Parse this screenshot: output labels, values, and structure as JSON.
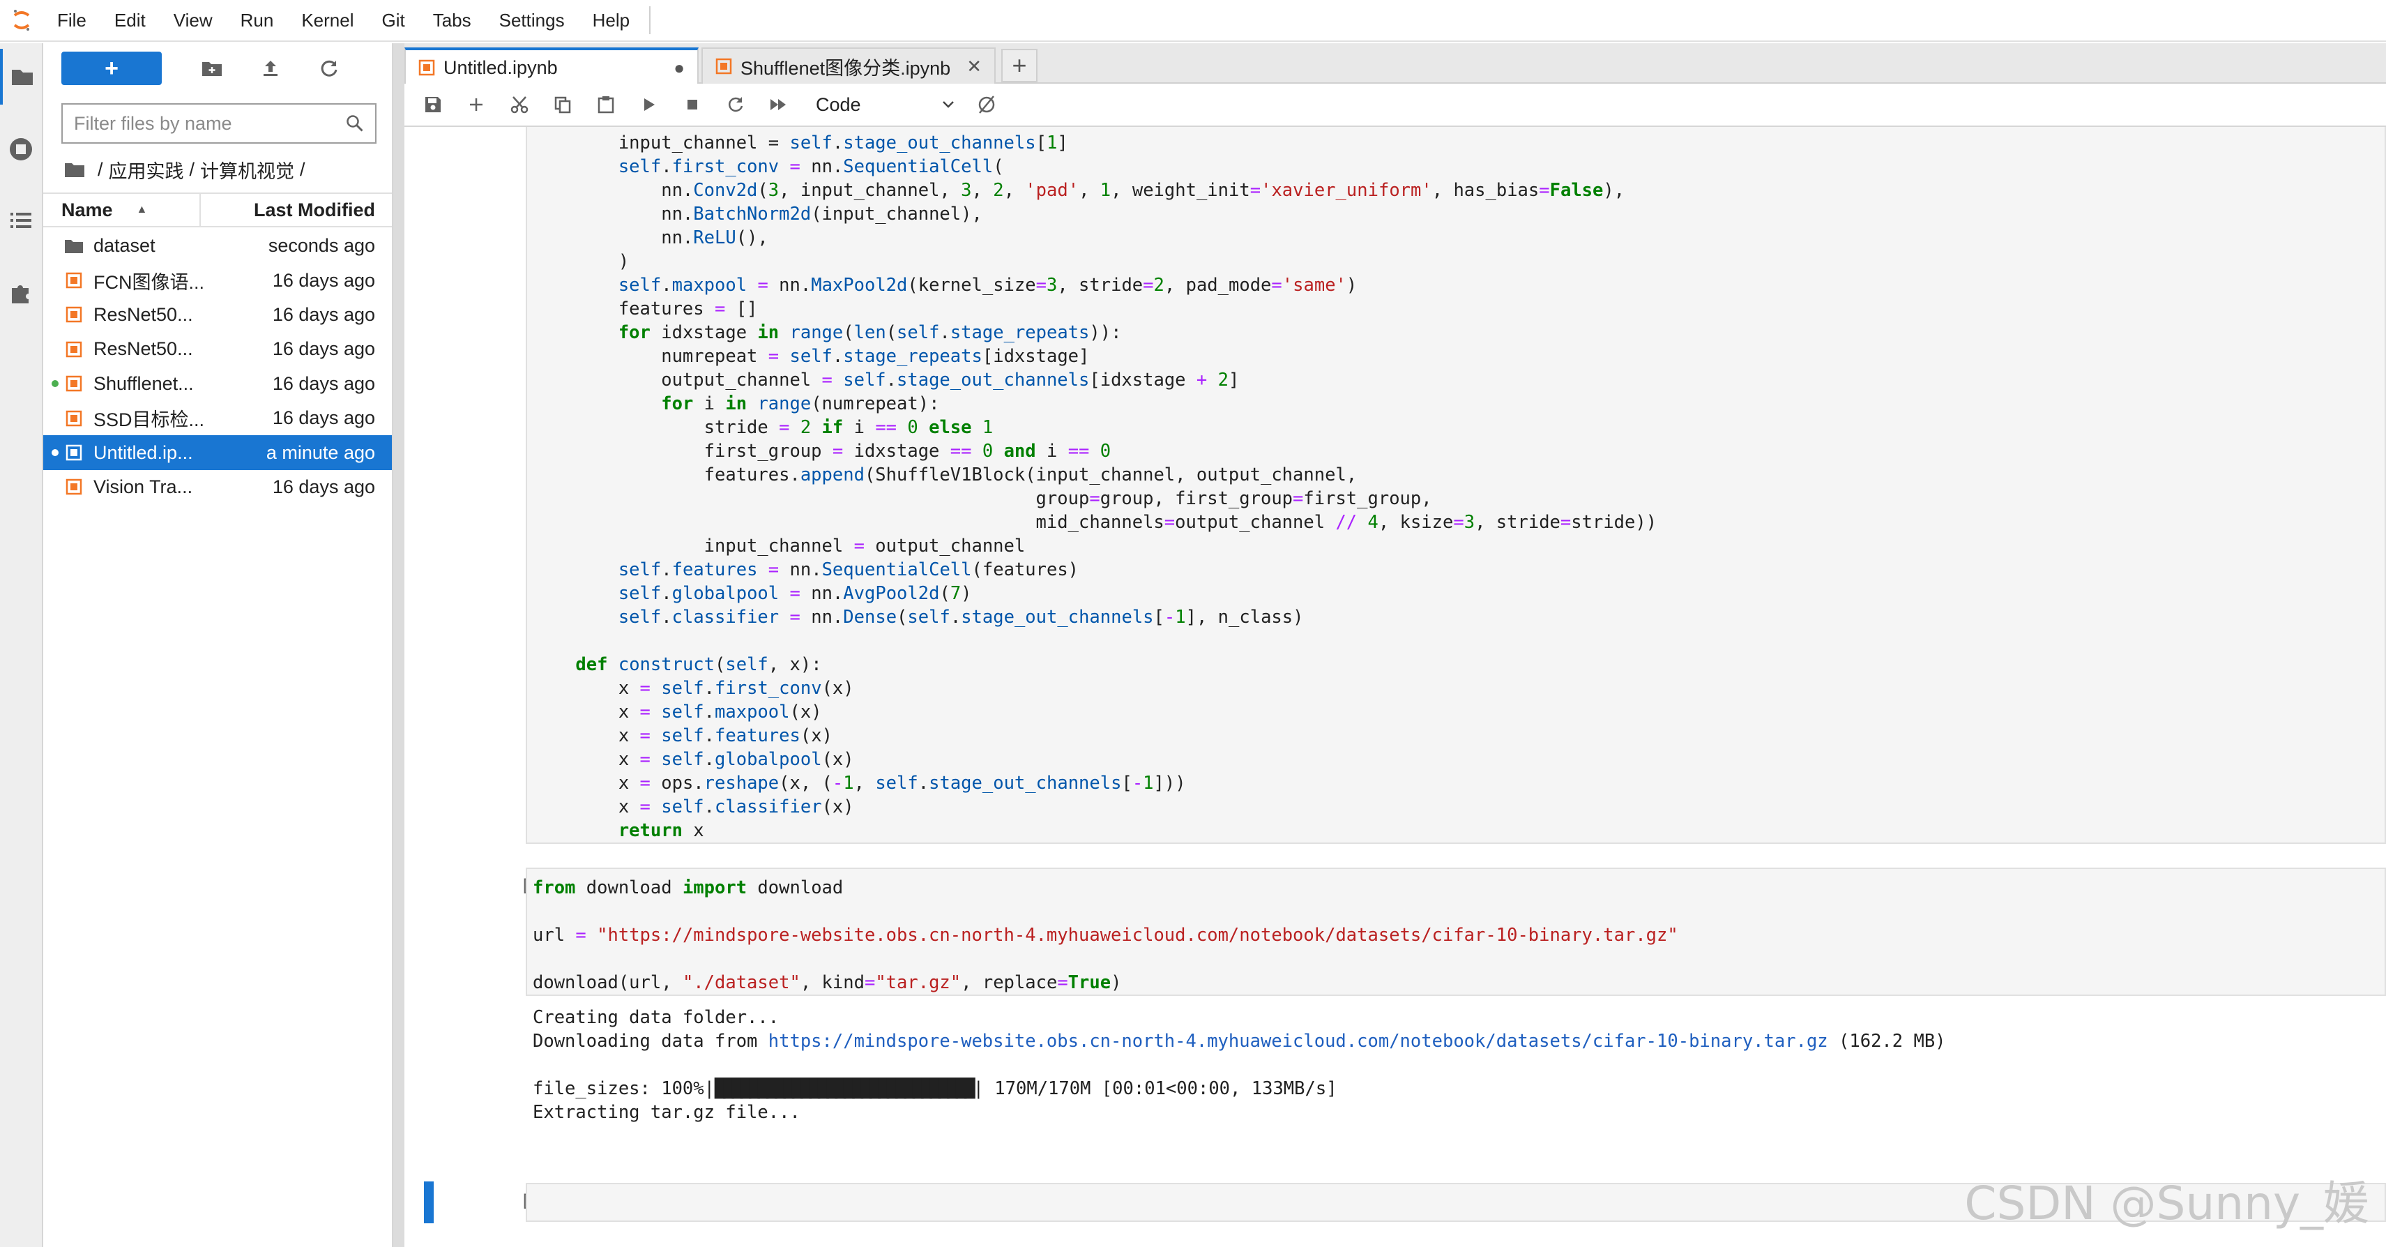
{
  "menubar": {
    "items": [
      "File",
      "Edit",
      "View",
      "Run",
      "Kernel",
      "Git",
      "Tabs",
      "Settings",
      "Help"
    ]
  },
  "activity_bar": {
    "items": [
      "folder-icon",
      "running-icon",
      "toc-icon",
      "extension-icon"
    ]
  },
  "filebrowser": {
    "new_button": "+",
    "filter_placeholder": "Filter files by name",
    "breadcrumbs": [
      "/",
      "应用实践",
      "/",
      "计算机视觉",
      "/"
    ],
    "col_name": "Name",
    "col_modified": "Last Modified",
    "files": [
      {
        "name": "dataset",
        "modified": "seconds ago",
        "type": "folder",
        "running": false,
        "selected": false
      },
      {
        "name": "FCN图像语...",
        "modified": "16 days ago",
        "type": "notebook",
        "running": false,
        "selected": false
      },
      {
        "name": "ResNet50...",
        "modified": "16 days ago",
        "type": "notebook",
        "running": false,
        "selected": false
      },
      {
        "name": "ResNet50...",
        "modified": "16 days ago",
        "type": "notebook",
        "running": false,
        "selected": false
      },
      {
        "name": "Shufflenet...",
        "modified": "16 days ago",
        "type": "notebook",
        "running": true,
        "selected": false
      },
      {
        "name": "SSD目标检...",
        "modified": "16 days ago",
        "type": "notebook",
        "running": false,
        "selected": false
      },
      {
        "name": "Untitled.ip...",
        "modified": "a minute ago",
        "type": "notebook",
        "running": true,
        "selected": true
      },
      {
        "name": "Vision Tra...",
        "modified": "16 days ago",
        "type": "notebook",
        "running": false,
        "selected": false
      }
    ]
  },
  "tabs": [
    {
      "label": "Untitled.ipynb",
      "active": true,
      "status": "●"
    },
    {
      "label": "Shufflenet图像分类.ipynb",
      "active": false,
      "status": "✕"
    }
  ],
  "new_tab": "+",
  "toolbar": {
    "cell_type": "Code"
  },
  "cells": [
    {
      "prompt": "",
      "code_html": "        input_channel = <span class=\"self\">self</span>.<span class=\"fn\">stage_out_channels</span>[<span class=\"num\">1</span>]\n        <span class=\"self\">self</span>.<span class=\"fn\">first_conv</span> <span class=\"op\">=</span> nn.<span class=\"fn\">SequentialCell</span>(\n            nn.<span class=\"fn\">Conv2d</span>(<span class=\"num\">3</span>, input_channel, <span class=\"num\">3</span>, <span class=\"num\">2</span>, <span class=\"str\">'pad'</span>, <span class=\"num\">1</span>, weight_init<span class=\"op\">=</span><span class=\"str\">'xavier_uniform'</span>, has_bias<span class=\"op\">=</span><span class=\"kw\">False</span>),\n            nn.<span class=\"fn\">BatchNorm2d</span>(input_channel),\n            nn.<span class=\"fn\">ReLU</span>(),\n        )\n        <span class=\"self\">self</span>.<span class=\"fn\">maxpool</span> <span class=\"op\">=</span> nn.<span class=\"fn\">MaxPool2d</span>(kernel_size<span class=\"op\">=</span><span class=\"num\">3</span>, stride<span class=\"op\">=</span><span class=\"num\">2</span>, pad_mode<span class=\"op\">=</span><span class=\"str\">'same'</span>)\n        features <span class=\"op\">=</span> []\n        <span class=\"kw\">for</span> idxstage <span class=\"kw\">in</span> <span class=\"fn\">range</span>(<span class=\"fn\">len</span>(<span class=\"self\">self</span>.<span class=\"fn\">stage_repeats</span>)):\n            numrepeat <span class=\"op\">=</span> <span class=\"self\">self</span>.<span class=\"fn\">stage_repeats</span>[idxstage]\n            output_channel <span class=\"op\">=</span> <span class=\"self\">self</span>.<span class=\"fn\">stage_out_channels</span>[idxstage <span class=\"op\">+</span> <span class=\"num\">2</span>]\n            <span class=\"kw\">for</span> i <span class=\"kw\">in</span> <span class=\"fn\">range</span>(numrepeat):\n                stride <span class=\"op\">=</span> <span class=\"num\">2</span> <span class=\"kw\">if</span> i <span class=\"op\">==</span> <span class=\"num\">0</span> <span class=\"kw\">else</span> <span class=\"num\">1</span>\n                first_group <span class=\"op\">=</span> idxstage <span class=\"op\">==</span> <span class=\"num\">0</span> <span class=\"kw\">and</span> i <span class=\"op\">==</span> <span class=\"num\">0</span>\n                features.<span class=\"fn\">append</span>(ShuffleV1Block(input_channel, output_channel,\n                                               group<span class=\"op\">=</span>group, first_group<span class=\"op\">=</span>first_group,\n                                               mid_channels<span class=\"op\">=</span>output_channel <span class=\"op\">//</span> <span class=\"num\">4</span>, ksize<span class=\"op\">=</span><span class=\"num\">3</span>, stride<span class=\"op\">=</span>stride))\n                input_channel <span class=\"op\">=</span> output_channel\n        <span class=\"self\">self</span>.<span class=\"fn\">features</span> <span class=\"op\">=</span> nn.<span class=\"fn\">SequentialCell</span>(features)\n        <span class=\"self\">self</span>.<span class=\"fn\">globalpool</span> <span class=\"op\">=</span> nn.<span class=\"fn\">AvgPool2d</span>(<span class=\"num\">7</span>)\n        <span class=\"self\">self</span>.<span class=\"fn\">classifier</span> <span class=\"op\">=</span> nn.<span class=\"fn\">Dense</span>(<span class=\"self\">self</span>.<span class=\"fn\">stage_out_channels</span>[<span class=\"op\">-</span><span class=\"num\">1</span>], n_class)\n\n    <span class=\"kw\">def</span> <span class=\"fn\">construct</span>(<span class=\"self\">self</span>, x):\n        x <span class=\"op\">=</span> <span class=\"self\">self</span>.<span class=\"fn\">first_conv</span>(x)\n        x <span class=\"op\">=</span> <span class=\"self\">self</span>.<span class=\"fn\">maxpool</span>(x)\n        x <span class=\"op\">=</span> <span class=\"self\">self</span>.<span class=\"fn\">features</span>(x)\n        x <span class=\"op\">=</span> <span class=\"self\">self</span>.<span class=\"fn\">globalpool</span>(x)\n        x <span class=\"op\">=</span> ops.<span class=\"fn\">reshape</span>(x, (<span class=\"op\">-</span><span class=\"num\">1</span>, <span class=\"self\">self</span>.<span class=\"fn\">stage_out_channels</span>[<span class=\"op\">-</span><span class=\"num\">1</span>]))\n        x <span class=\"op\">=</span> <span class=\"self\">self</span>.<span class=\"fn\">classifier</span>(x)\n        <span class=\"kw\">return</span> x"
    },
    {
      "prompt": "[*]:",
      "code_html": "<span class=\"kw\">from</span> download <span class=\"kw\">import</span> download\n\nurl <span class=\"op\">=</span> <span class=\"str\">\"https://mindspore-website.obs.cn-north-4.myhuaweicloud.com/notebook/datasets/cifar-10-binary.tar.gz\"</span>\n\ndownload(url, <span class=\"str\">\"./dataset\"</span>, kind<span class=\"op\">=</span><span class=\"str\">\"tar.gz\"</span>, replace<span class=\"op\">=</span><span class=\"kw\">True</span>)",
      "output": {
        "line1": "Creating data folder...",
        "line2_prefix": "Downloading data from ",
        "line2_link": "https://mindspore-website.obs.cn-north-4.myhuaweicloud.com/notebook/datasets/cifar-10-binary.tar.gz",
        "line2_suffix": " (162.2 MB)",
        "progress_prefix": "file_sizes: 100%|",
        "progress_bar": "██████████████████████████████",
        "progress_suffix": "| 170M/170M [00:01<00:00, 133MB/s]",
        "line4": "Extracting tar.gz file..."
      }
    },
    {
      "prompt": "[ ]:",
      "code_html": ""
    }
  ],
  "watermark": "CSDN @Sunny_媛"
}
